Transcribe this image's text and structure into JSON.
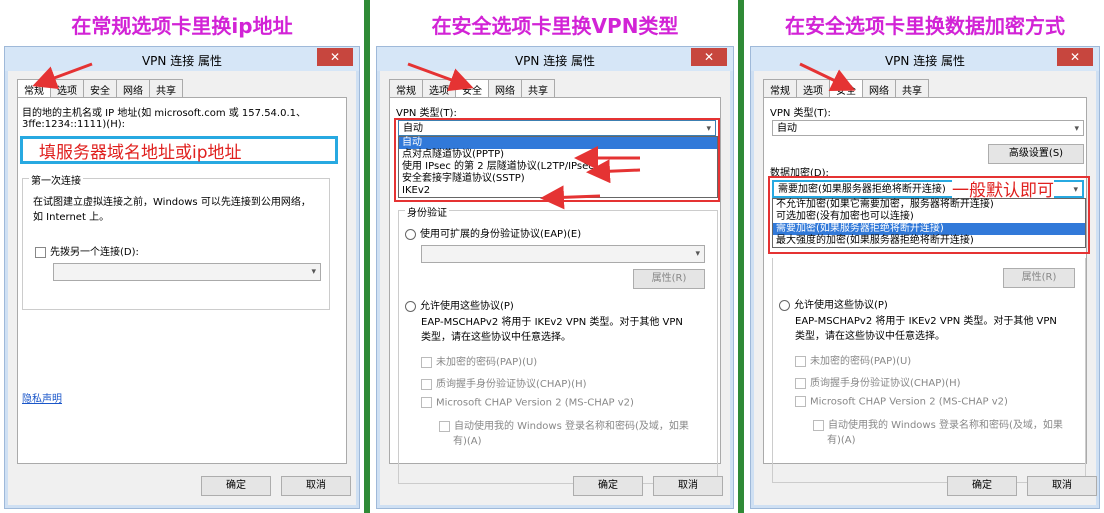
{
  "headings": [
    "在常规选项卡里换ip地址",
    "在安全选项卡里换VPN类型",
    "在安全选项卡里换数据加密方式"
  ],
  "dialog": {
    "title": "VPN 连接 属性",
    "close_glyph": "✕",
    "tabs": [
      "常规",
      "选项",
      "安全",
      "网络",
      "共享"
    ],
    "ok": "确定",
    "cancel": "取消"
  },
  "general": {
    "host_label_line1": "目的地的主机名或 IP 地址(如 microsoft.com 或 157.54.0.1、",
    "host_label_line2": "3ffe:1234::1111)(H):",
    "host_annotation": "填服务器域名地址或ip地址",
    "first_connect_title": "第一次连接",
    "first_connect_desc1": "在试图建立虚拟连接之前，Windows 可以先连接到公用网络，",
    "first_connect_desc2": "如 Internet 上。",
    "dial_first": "先拨另一个连接(D):",
    "privacy_link": "隐私声明"
  },
  "security": {
    "vpn_type_label": "VPN 类型(T):",
    "vpn_type_value": "自动",
    "vpn_type_options": [
      "自动",
      "点对点隧道协议(PPTP)",
      "使用 IPsec 的第 2 层隧道协议(L2TP/IPsec)",
      "安全套接字隧道协议(SSTP)",
      "IKEv2"
    ],
    "advanced_button": "高级设置(S)",
    "encryption_label": "数据加密(D):",
    "encryption_value": "需要加密(如果服务器拒绝将断开连接)",
    "encryption_annotation": "一般默认即可",
    "encryption_options": [
      "不允许加密(如果它需要加密，服务器将断开连接)",
      "可选加密(没有加密也可以连接)",
      "需要加密(如果服务器拒绝将断开连接)",
      "最大强度的加密(如果服务器拒绝将断开连接)"
    ],
    "auth_label": "身份验证",
    "eap_radio": "使用可扩展的身份验证协议(EAP)(E)",
    "properties_button": "属性(R)",
    "allow_protocols": "允许使用这些协议(P)",
    "mschap_note1": "EAP-MSCHAPv2 将用于 IKEv2 VPN 类型。对于其他 VPN",
    "mschap_note2": "类型，请在这些协议中任意选择。",
    "pap": "未加密的密码(PAP)(U)",
    "chap": "质询握手身份验证协议(CHAP)(H)",
    "mschap": "Microsoft CHAP Version 2 (MS-CHAP v2)",
    "auto_windows1": "自动使用我的 Windows 登录名称和密码(及域，如果",
    "auto_windows2": "有)(A)"
  },
  "colors": {
    "heading": "#d223d6",
    "annotation_red": "#e0201e",
    "highlight_cyan": "#27a9e1",
    "divider_green": "#2f8a36"
  }
}
